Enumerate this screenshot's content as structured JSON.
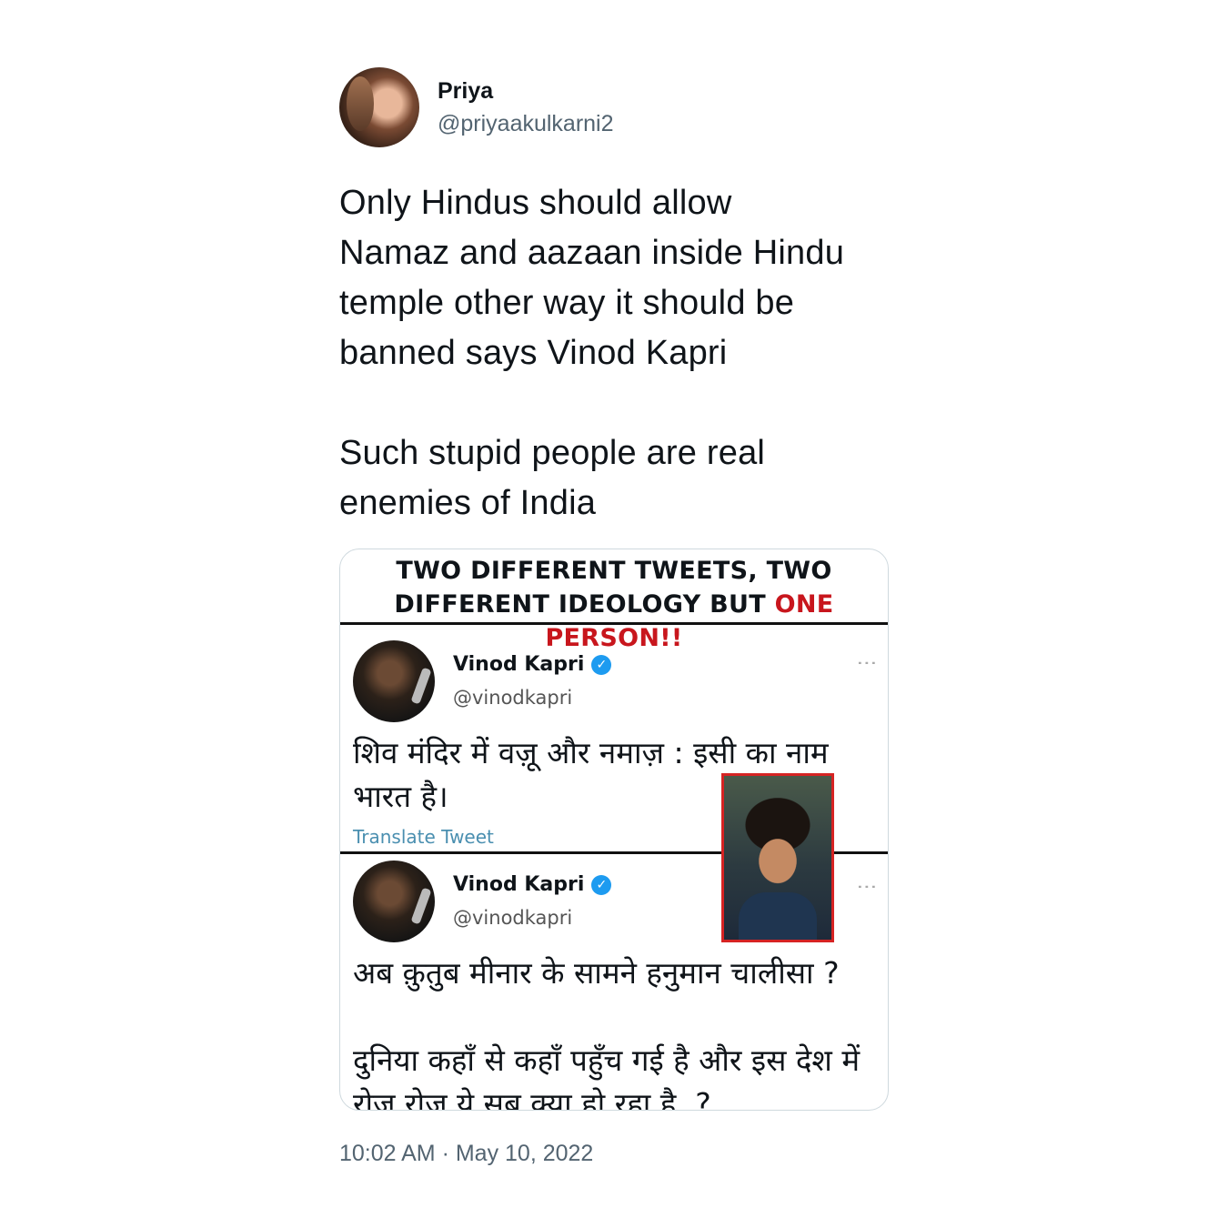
{
  "author": {
    "display_name": "Priya",
    "handle": "@priyaakulkarni2"
  },
  "tweet": {
    "text": "Only Hindus should allow\nNamaz and aazaan inside Hindu\ntemple other way it should be\nbanned says Vinod Kapri\n\nSuch stupid people are real\nenemies of India",
    "timestamp": "10:02 AM · May 10, 2022"
  },
  "media": {
    "headline_line1": "TWO DIFFERENT TWEETS, TWO",
    "headline_line2_black": "DIFFERENT IDEOLOGY BUT ",
    "headline_line2_red": "ONE PERSON!!",
    "embeds": [
      {
        "name": "Vinod Kapri",
        "handle": "@vinodkapri",
        "text": "शिव मंदिर में वज़ू और नमाज़ : इसी का नाम\nभारत है।",
        "translate": "Translate Tweet"
      },
      {
        "name": "Vinod Kapri",
        "handle": "@vinodkapri",
        "text": "अब क़ुतुब मीनार के सामने हनुमान चालीसा ?\n\nदुनिया कहाँ से कहाँ पहुँच गई है और इस देश में\nरोज़ रोज़ ये सब क्या हो रहा है  ?"
      }
    ]
  },
  "colors": {
    "headline_red": "#c8161d",
    "verified_blue": "#1d9bf0",
    "photo_border": "#d62323",
    "muted_text": "#536471"
  }
}
